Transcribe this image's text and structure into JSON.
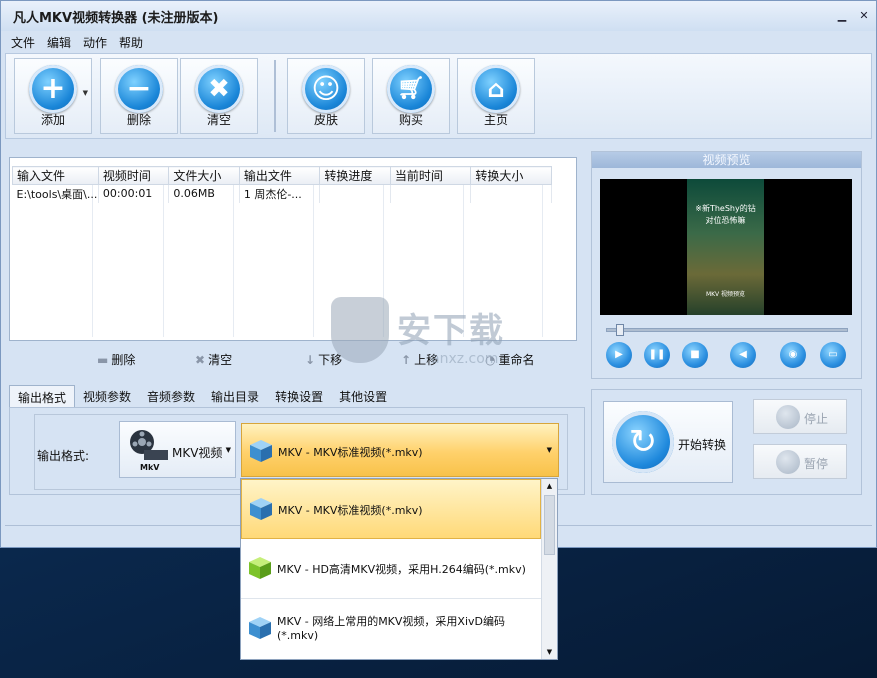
{
  "window": {
    "title": "凡人MKV视频转换器   (未注册版本)",
    "minimize_icon": "minimize-icon",
    "close_icon": "close-icon"
  },
  "menu": [
    "文件",
    "编辑",
    "动作",
    "帮助"
  ],
  "toolbar": {
    "add": "添加",
    "delete": "删除",
    "clear": "清空",
    "skin": "皮肤",
    "buy": "购买",
    "home": "主页"
  },
  "file_list": {
    "columns": [
      "输入文件",
      "视频时间",
      "文件大小",
      "输出文件",
      "转换进度",
      "当前时间",
      "转换大小"
    ],
    "rows": [
      [
        "E:\\tools\\桌面\\...",
        "00:00:01",
        "0.06MB",
        "1 周杰伦-...",
        "",
        "",
        ""
      ]
    ]
  },
  "list_actions": {
    "delete": "删除",
    "clear": "清空",
    "down": "下移",
    "up": "上移",
    "rename": "重命名"
  },
  "tabs": [
    "输出格式",
    "视频参数",
    "音频参数",
    "输出目录",
    "转换设置",
    "其他设置"
  ],
  "output": {
    "label": "输出格式:",
    "category": "MKV视频",
    "category_tag": "MkV",
    "selected_format": "MKV - MKV标准视频(*.mkv)"
  },
  "dropdown": {
    "options": [
      "MKV - MKV标准视频(*.mkv)",
      "MKV - HD高清MKV视频，采用H.264编码(*.mkv)",
      "MKV - 网络上常用的MKV视频，采用XivD编码",
      "(*.mkv)"
    ]
  },
  "preview": {
    "title": "视频预览",
    "frame_caption_1": "※新TheShy的钻",
    "frame_caption_2": "对位恐怖嘛",
    "frame_caption_3": "MKV 视频预览",
    "progress_fraction": 0.04
  },
  "actions": {
    "start": "开始转换",
    "stop": "停止",
    "pause": "暂停"
  },
  "watermark": {
    "text": "安下载",
    "sub": "anxz.com"
  },
  "colors": {
    "accent_blue": "#1a86d8",
    "selection_yellow": "#ffd16b",
    "window_bg": "#d6e3f3"
  }
}
